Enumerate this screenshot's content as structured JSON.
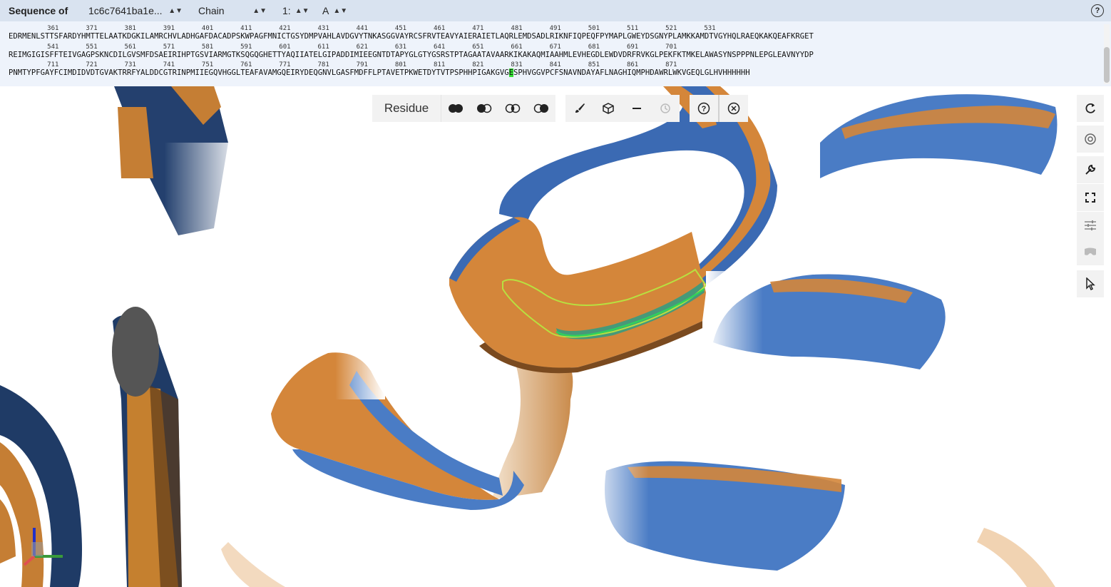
{
  "header": {
    "label": "Sequence of",
    "entry_value": "1c6c7641ba1e...",
    "scope_value": "Chain",
    "index_value": "1:",
    "chain_value": "A"
  },
  "sequence": {
    "rows": [
      {
        "numbers": "          361       371       381       391       401       411       421       431       441       451       461       471       481       491       501       511       521       531",
        "residues": "EDRMENLSTTSFARDYHMTTELAATKDGKILAMRCHVLADHGAFDACADPSKWPAGFMNICTGSYDMPVAHLAVDGVYTNKASGGVAYRCSFRVTEAVYAIERAIETLAQRLEMDSADLRIKNFIQPEQFPYMAPLGWEYDSGNYPLAMKKAMDTVGYHQLRAEQKAKQEAFKRGET"
      },
      {
        "numbers": "          541       551       561       571       581       591       601       611       621       631       641       651       661       671       681       691       701",
        "residues": "REIMGIGISFFTEIVGAGPSKNCDILGVSMFDSAEIRIHPTGSVIARMGTKSQGQGHETTYAQIIATELGIPADDIMIEEGNTDTAPYGLGTYGSRSTPTAGAATAVAARKIKAKAQMIAAHMLEVHEGDLEWDVDRFRVKGLPEKFKTMKELAWASYNSPPPNLEPGLEAVNYYDP"
      },
      {
        "numbers": "          711       721       731       741       751       761       771       781       791       801       811       821       831       841       851       861       871",
        "residues_before": "PNMTYPFGAYFCIMDIDVDTGVAKTRRFYALDDCGTRINPMIIEGQVHGGLTEAFAVAMGQEIRYDEQGNVLGASFMDFFLPTAVETPKWETDYTVTPSPHHPIGAKGVG",
        "residues_highlight": "E",
        "residues_after": "SPHVGGVPCFSNAVNDAYAFLNAGHIQMPHDAWRLWKVGEQLGLHVHHHHHH"
      }
    ]
  },
  "toolbar": {
    "mode_label": "Residue",
    "icons": [
      "union-icon",
      "subtract-icon",
      "intersect-icon",
      "set-icon",
      "brush-icon",
      "cube-icon",
      "minus-icon",
      "history-icon",
      "help-icon",
      "close-icon"
    ]
  },
  "side_icons": [
    "rotate-icon",
    "camera-icon",
    "wrench-icon",
    "expand-icon",
    "sliders-icon",
    "vr-icon",
    "cursor-icon"
  ],
  "colors": {
    "orange": "#d4863a",
    "blue": "#4a7cc5",
    "selection": "#2fd35b",
    "header_bg": "#d9e3f0"
  }
}
